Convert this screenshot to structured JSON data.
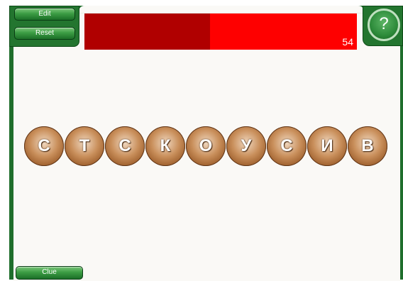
{
  "toolbar": {
    "edit_label": "Edit",
    "reset_label": "Reset",
    "clue_label": "Clue"
  },
  "help": {
    "label": "?"
  },
  "timer": {
    "remaining": "54",
    "elapsed_fraction": 0.46
  },
  "tiles": [
    "С",
    "Т",
    "С",
    "К",
    "О",
    "У",
    "С",
    "И",
    "В"
  ],
  "colors": {
    "frame_green": "#1f6e2c",
    "timer_red": "#fe0000",
    "timer_dark_red": "#b00000",
    "tile_brown": "#a0622f"
  }
}
